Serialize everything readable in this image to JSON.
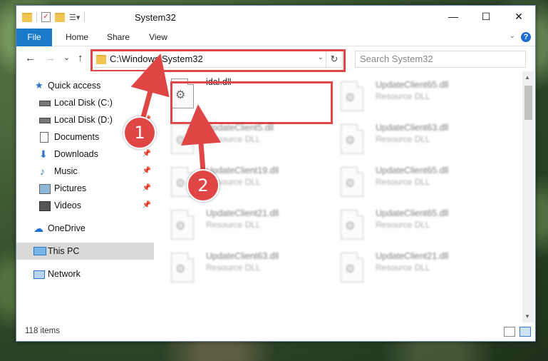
{
  "window": {
    "title": "System32",
    "minimize": "—",
    "maximize": "☐",
    "close": "✕"
  },
  "ribbon": {
    "tabs": [
      "File",
      "Home",
      "Share",
      "View"
    ],
    "help": "?"
  },
  "nav": {
    "back": "←",
    "forward": "→",
    "recent": "⌄",
    "up": "↑",
    "address": "C:\\Windows\\System32",
    "search_placeholder": "Search System32",
    "refresh": "↻"
  },
  "sidebar": {
    "items": [
      {
        "label": "Quick access",
        "icon": "star-icon"
      },
      {
        "label": "Local Disk (C:)",
        "icon": "drive-icon"
      },
      {
        "label": "Local Disk (D:)",
        "icon": "drive-icon"
      },
      {
        "label": "Documents",
        "icon": "documents-icon"
      },
      {
        "label": "Downloads",
        "icon": "download-icon"
      },
      {
        "label": "Music",
        "icon": "music-icon"
      },
      {
        "label": "Pictures",
        "icon": "pictures-icon"
      },
      {
        "label": "Videos",
        "icon": "videos-icon"
      },
      {
        "label": "OneDrive",
        "icon": "cloud-icon"
      },
      {
        "label": "This PC",
        "icon": "pc-icon"
      },
      {
        "label": "Network",
        "icon": "network-icon"
      }
    ]
  },
  "files": {
    "col1": [
      {
        "name": "idal.dll",
        "type": ""
      },
      {
        "name": "UpdateClient5.dll",
        "type": "Resource DLL"
      },
      {
        "name": "UpdateClient19.dll",
        "type": "Resource DLL"
      },
      {
        "name": "UpdateClient21.dll",
        "type": "Resource DLL"
      },
      {
        "name": "UpdateClient63.dll",
        "type": "Resource DLL"
      }
    ],
    "col2": [
      {
        "name": "UpdateClient65.dll",
        "type": "Resource DLL"
      },
      {
        "name": "UpdateClient63.dll",
        "type": "Resource DLL"
      },
      {
        "name": "UpdateClient65.dll",
        "type": "Resource DLL"
      },
      {
        "name": "UpdateClient65.dll",
        "type": "Resource DLL"
      },
      {
        "name": "UpdateClient21.dll",
        "type": "Resource DLL"
      }
    ]
  },
  "status": {
    "count": "118 items"
  },
  "callouts": {
    "one": "1",
    "two": "2"
  },
  "colors": {
    "accent": "#1979ca",
    "highlight": "#e04646"
  }
}
